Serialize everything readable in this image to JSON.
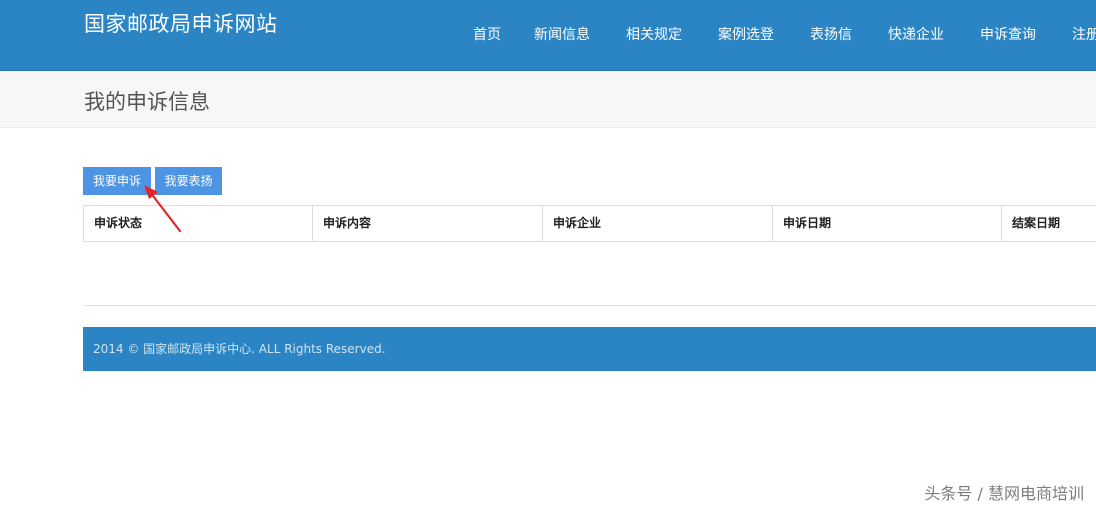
{
  "header": {
    "site_title": "国家邮政局申诉网站",
    "nav": [
      {
        "label": "首页"
      },
      {
        "label": "新闻信息"
      },
      {
        "label": "相关规定"
      },
      {
        "label": "案例选登"
      },
      {
        "label": "表扬信"
      },
      {
        "label": "快递企业"
      },
      {
        "label": "申诉查询"
      },
      {
        "label": "注册"
      }
    ]
  },
  "page": {
    "title": "我的申诉信息"
  },
  "actions": {
    "complain_label": "我要申诉",
    "praise_label": "我要表扬"
  },
  "table": {
    "columns": [
      "申诉状态",
      "申诉内容",
      "申诉企业",
      "申诉日期",
      "结案日期"
    ]
  },
  "footer": {
    "copyright": "2014 © 国家邮政局申诉中心. ALL Rights Reserved."
  },
  "watermark": {
    "text": "头条号 / 慧网电商培训"
  },
  "colors": {
    "header_bg": "#2b85c4",
    "button_bg": "#4d94e4",
    "annotation_arrow": "#e0252b"
  }
}
